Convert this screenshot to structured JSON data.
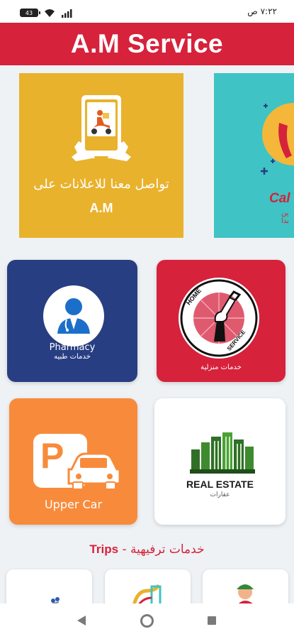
{
  "status_bar": {
    "battery": "43",
    "time": "٧:٢٢ ص"
  },
  "app": {
    "title": "A.M Service"
  },
  "carousel": {
    "slide1_line1": "تواصل معنا للاعلانات على",
    "slide1_line2": "A.M",
    "slide2_title": "Cal",
    "slide2_sub": "ين بدا"
  },
  "cards": {
    "pharmacy": {
      "title": "Pharmacy",
      "subtitle": "خدمات طبيه"
    },
    "home_service": {
      "badge_top": "HOME",
      "badge_bottom": "SERVICE",
      "label": "خدمات منزلية"
    },
    "upper_car": {
      "label": "Upper Car",
      "sign": "P"
    },
    "real_estate": {
      "title": "REAL ESTATE",
      "subtitle": "عقارات"
    }
  },
  "section": {
    "arabic": "خدمات ترفيهية",
    "separator": " - ",
    "english": "Trips"
  },
  "colors": {
    "brand_red": "#d6223b",
    "pharmacy_blue": "#283e82",
    "upper_orange": "#f88b3b",
    "ad_yellow": "#e9b22d",
    "teal": "#3fc3c4"
  }
}
